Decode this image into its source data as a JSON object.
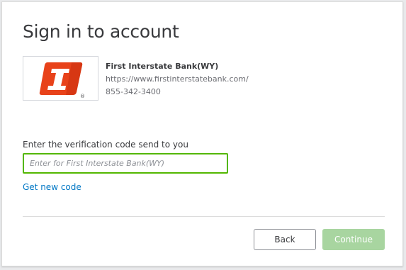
{
  "dialog": {
    "title": "Sign in to account"
  },
  "bank": {
    "name": "First Interstate Bank(WY)",
    "url": "https://www.firstinterstatebank.com/",
    "phone": "855-342-3400",
    "logo_icon": "first-interstate-logo-icon",
    "logo_color": "#e8421a"
  },
  "verification": {
    "label": "Enter the verification code send to you",
    "placeholder": "Enter for First Interstate Bank(WY)",
    "value": ""
  },
  "links": {
    "get_new_code": "Get new code"
  },
  "buttons": {
    "back": "Back",
    "continue": "Continue",
    "continue_color": "#a8d5a0"
  },
  "colors": {
    "focus_border": "#53b700",
    "link": "#0077c5"
  }
}
